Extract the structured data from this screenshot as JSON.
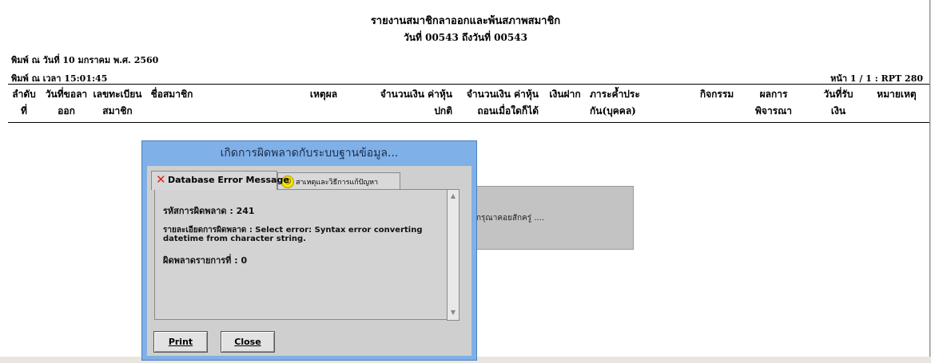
{
  "report": {
    "title": "รายงานสมาชิกลาออกและพ้นสภาพสมาชิก",
    "subtitle": "วันที่ 00543  ถึงวันที่  00543",
    "print_date": "พิมพ์ ณ วันที่ 10 มกราคม พ.ศ. 2560",
    "print_time": "พิมพ์ ณ เวลา 15:01:45",
    "page_info": "หน้า 1 / 1   : RPT 280"
  },
  "columns": [
    {
      "line1": "ลำดับ",
      "line2": "ที่"
    },
    {
      "line1": "วันที่ขอลา",
      "line2": "ออก"
    },
    {
      "line1": "เลขทะเบียน",
      "line2": "สมาชิก"
    },
    {
      "line1": "ชื่อสมาชิก",
      "line2": ""
    },
    {
      "line1": "เหตุผล",
      "line2": ""
    },
    {
      "line1": "จำนวนเงิน ค่าหุ้น",
      "line2": "ปกติ"
    },
    {
      "line1": "จำนวนเงิน ค่าหุ้น",
      "line2": "ถอนเมื่อใดก็ได้"
    },
    {
      "line1": "เงินฝาก",
      "line2": ""
    },
    {
      "line1": "ภาระค้ำประ",
      "line2": "กัน(บุคคล)"
    },
    {
      "line1": "กิจกรรม",
      "line2": ""
    },
    {
      "line1": "ผลการ",
      "line2": "พิจารณา"
    },
    {
      "line1": "วันที่รับ",
      "line2": "เงิน"
    },
    {
      "line1": "หมายเหตุ",
      "line2": ""
    }
  ],
  "dialog": {
    "title": "เกิดการผิดพลาดกับระบบฐานข้อมูล...",
    "tab_error": "Database Error Message",
    "tab_solution": "สาเหตุและวิธีการแก้ปัญหา",
    "error_code": "รหัสการผิดพลาด : 241",
    "error_detail_1": "รายละเอียดการผิดพลาด : Select error: Syntax error converting",
    "error_detail_2": "datetime from character string.",
    "error_row": "ผิดพลาดรายการที่ : 0",
    "print_label": "Print",
    "close_label": "Close"
  },
  "waiting": {
    "text": "กรุณาคอยสักครู่ ...."
  }
}
